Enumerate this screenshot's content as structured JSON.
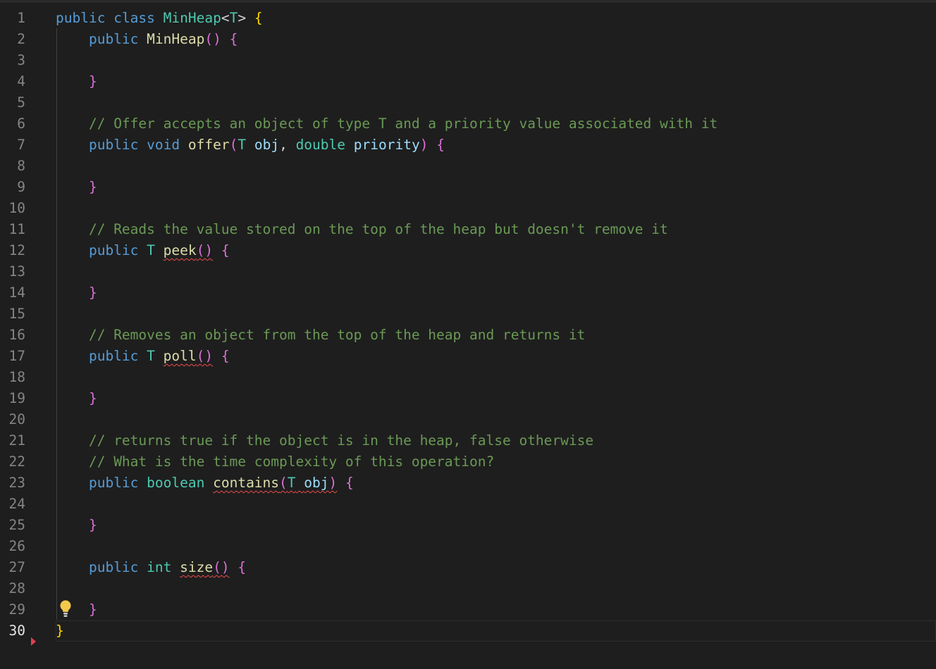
{
  "editor": {
    "lines": [
      {
        "n": "1",
        "tokens": [
          [
            "kw",
            "public"
          ],
          [
            "pl",
            " "
          ],
          [
            "kw",
            "class"
          ],
          [
            "pl",
            " "
          ],
          [
            "ty",
            "MinHeap"
          ],
          [
            "pl",
            "<"
          ],
          [
            "ty",
            "T"
          ],
          [
            "pl",
            "> "
          ],
          [
            "br1",
            "{"
          ]
        ]
      },
      {
        "n": "2",
        "tokens": [
          [
            "pl",
            "    "
          ],
          [
            "kw",
            "public"
          ],
          [
            "pl",
            " "
          ],
          [
            "fn",
            "MinHeap"
          ],
          [
            "br2",
            "()"
          ],
          [
            "pl",
            " "
          ],
          [
            "br2",
            "{"
          ]
        ]
      },
      {
        "n": "3",
        "tokens": []
      },
      {
        "n": "4",
        "tokens": [
          [
            "pl",
            "    "
          ],
          [
            "br2",
            "}"
          ]
        ]
      },
      {
        "n": "5",
        "tokens": []
      },
      {
        "n": "6",
        "tokens": [
          [
            "pl",
            "    "
          ],
          [
            "cm",
            "// Offer accepts an object of type T and a priority value associated with it"
          ]
        ]
      },
      {
        "n": "7",
        "tokens": [
          [
            "pl",
            "    "
          ],
          [
            "kw",
            "public"
          ],
          [
            "pl",
            " "
          ],
          [
            "kw",
            "void"
          ],
          [
            "pl",
            " "
          ],
          [
            "fn",
            "offer"
          ],
          [
            "br2",
            "("
          ],
          [
            "ty",
            "T"
          ],
          [
            "pl",
            " "
          ],
          [
            "par",
            "obj"
          ],
          [
            "pl",
            ", "
          ],
          [
            "ty",
            "double"
          ],
          [
            "pl",
            " "
          ],
          [
            "par",
            "priority"
          ],
          [
            "br2",
            ")"
          ],
          [
            "pl",
            " "
          ],
          [
            "br2",
            "{"
          ]
        ]
      },
      {
        "n": "8",
        "tokens": []
      },
      {
        "n": "9",
        "tokens": [
          [
            "pl",
            "    "
          ],
          [
            "br2",
            "}"
          ]
        ]
      },
      {
        "n": "10",
        "tokens": []
      },
      {
        "n": "11",
        "tokens": [
          [
            "pl",
            "    "
          ],
          [
            "cm",
            "// Reads the value stored on the top of the heap but doesn't remove it"
          ]
        ]
      },
      {
        "n": "12",
        "tokens": [
          [
            "pl",
            "    "
          ],
          [
            "kw",
            "public"
          ],
          [
            "pl",
            " "
          ],
          [
            "ty",
            "T"
          ],
          [
            "pl",
            " "
          ],
          [
            "fn squiggle",
            "peek"
          ],
          [
            "br2 squiggle",
            "()"
          ],
          [
            "pl",
            " "
          ],
          [
            "br2",
            "{"
          ]
        ]
      },
      {
        "n": "13",
        "tokens": []
      },
      {
        "n": "14",
        "tokens": [
          [
            "pl",
            "    "
          ],
          [
            "br2",
            "}"
          ]
        ]
      },
      {
        "n": "15",
        "tokens": []
      },
      {
        "n": "16",
        "tokens": [
          [
            "pl",
            "    "
          ],
          [
            "cm",
            "// Removes an object from the top of the heap and returns it"
          ]
        ]
      },
      {
        "n": "17",
        "tokens": [
          [
            "pl",
            "    "
          ],
          [
            "kw",
            "public"
          ],
          [
            "pl",
            " "
          ],
          [
            "ty",
            "T"
          ],
          [
            "pl",
            " "
          ],
          [
            "fn squiggle",
            "poll"
          ],
          [
            "br2 squiggle",
            "()"
          ],
          [
            "pl",
            " "
          ],
          [
            "br2",
            "{"
          ]
        ]
      },
      {
        "n": "18",
        "tokens": []
      },
      {
        "n": "19",
        "tokens": [
          [
            "pl",
            "    "
          ],
          [
            "br2",
            "}"
          ]
        ]
      },
      {
        "n": "20",
        "tokens": []
      },
      {
        "n": "21",
        "tokens": [
          [
            "pl",
            "    "
          ],
          [
            "cm",
            "// returns true if the object is in the heap, false otherwise"
          ]
        ]
      },
      {
        "n": "22",
        "tokens": [
          [
            "pl",
            "    "
          ],
          [
            "cm",
            "// What is the time complexity of this operation?"
          ]
        ]
      },
      {
        "n": "23",
        "tokens": [
          [
            "pl",
            "    "
          ],
          [
            "kw",
            "public"
          ],
          [
            "pl",
            " "
          ],
          [
            "ty",
            "boolean"
          ],
          [
            "pl",
            " "
          ],
          [
            "fn squiggle",
            "contains"
          ],
          [
            "br2 squiggle",
            "("
          ],
          [
            "ty squiggle",
            "T"
          ],
          [
            "pl squiggle",
            " "
          ],
          [
            "par squiggle",
            "obj"
          ],
          [
            "br2 squiggle",
            ")"
          ],
          [
            "pl",
            " "
          ],
          [
            "br2",
            "{"
          ]
        ]
      },
      {
        "n": "24",
        "tokens": []
      },
      {
        "n": "25",
        "tokens": [
          [
            "pl",
            "    "
          ],
          [
            "br2",
            "}"
          ]
        ]
      },
      {
        "n": "26",
        "tokens": []
      },
      {
        "n": "27",
        "tokens": [
          [
            "pl",
            "    "
          ],
          [
            "kw",
            "public"
          ],
          [
            "pl",
            " "
          ],
          [
            "ty",
            "int"
          ],
          [
            "pl",
            " "
          ],
          [
            "fn squiggle",
            "size"
          ],
          [
            "br2 squiggle",
            "()"
          ],
          [
            "pl",
            " "
          ],
          [
            "br2",
            "{"
          ]
        ]
      },
      {
        "n": "28",
        "tokens": []
      },
      {
        "n": "29",
        "tokens": [
          [
            "pl",
            "    "
          ],
          [
            "br2",
            "}"
          ]
        ]
      },
      {
        "n": "30",
        "tokens": [
          [
            "br1",
            "}"
          ]
        ],
        "current": true
      }
    ],
    "colors": {
      "background": "#1e1e1e",
      "keyword": "#569cd6",
      "type": "#4ec9b0",
      "function": "#dcdcaa",
      "parameter": "#9cdcfe",
      "comment": "#6a9955",
      "bracket_level1": "#ffd700",
      "bracket_level2": "#da70d6",
      "error_squiggle": "#f14c4c"
    },
    "icons": {
      "lightbulb": "lightbulb-icon",
      "breakpoint_hint": "breakpoint-hint-icon"
    }
  }
}
